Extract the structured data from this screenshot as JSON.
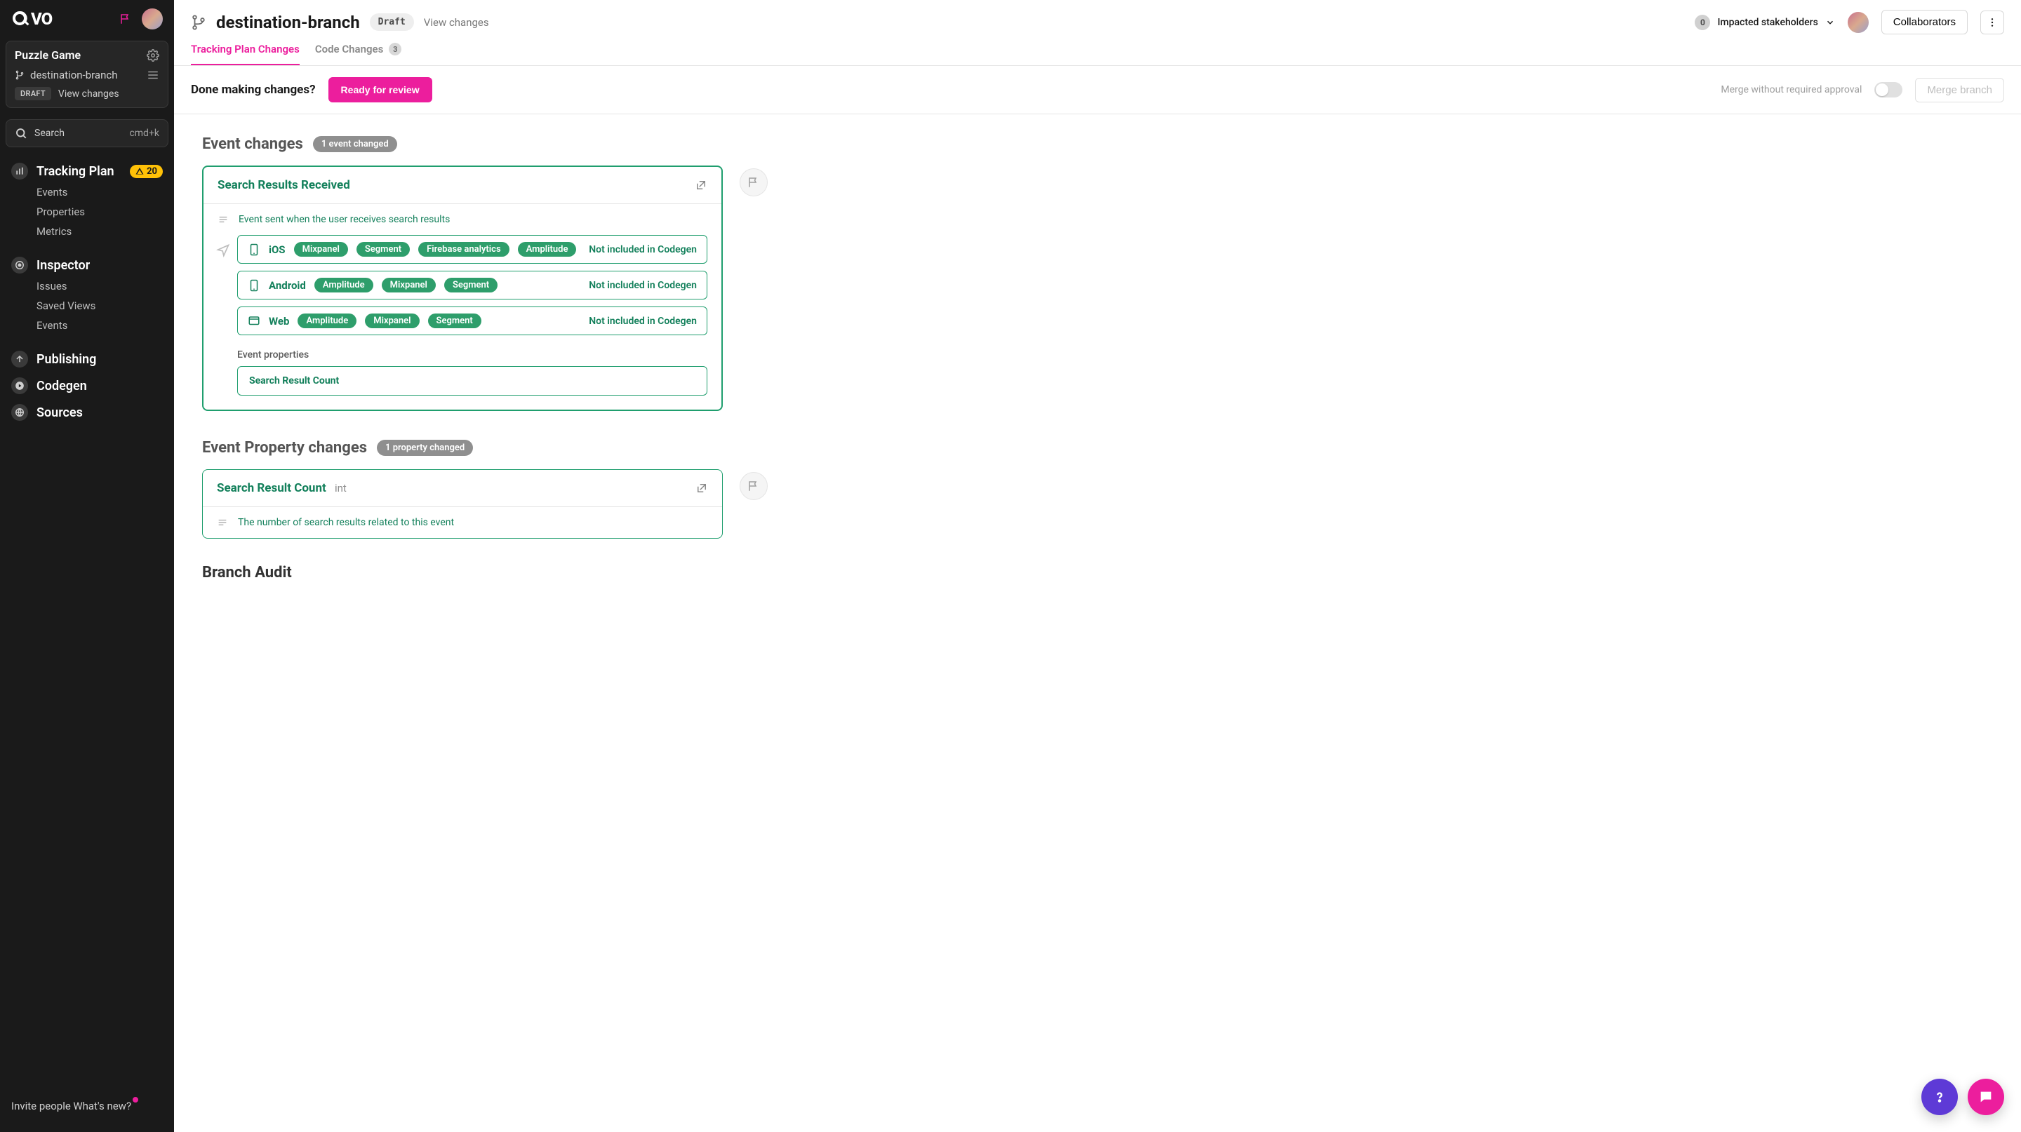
{
  "sidebar": {
    "logo_text": "QVO",
    "project": "Puzzle Game",
    "branch": "destination-branch",
    "draft_tag": "DRAFT",
    "view_changes": "View changes",
    "search_placeholder": "Search",
    "search_shortcut": "cmd+k",
    "sections": {
      "tracking_plan": {
        "label": "Tracking Plan",
        "warn_count": "20",
        "subs": [
          "Events",
          "Properties",
          "Metrics"
        ]
      },
      "inspector": {
        "label": "Inspector",
        "subs": [
          "Issues",
          "Saved Views",
          "Events"
        ]
      },
      "publishing": {
        "label": "Publishing"
      },
      "codegen": {
        "label": "Codegen"
      },
      "sources": {
        "label": "Sources"
      }
    },
    "footer": {
      "invite": "Invite people",
      "whats_new": "What's new?"
    }
  },
  "header": {
    "branch": "destination-branch",
    "draft_chip": "Draft",
    "view_changes": "View changes",
    "stakeholders": {
      "count": "0",
      "label": "Impacted stakeholders"
    },
    "collaborators": "Collaborators"
  },
  "tabs": {
    "tracking": "Tracking Plan Changes",
    "code": "Code Changes",
    "code_count": "3"
  },
  "actionbar": {
    "question": "Done making changes?",
    "ready": "Ready for review",
    "merge_without": "Merge without required approval",
    "merge": "Merge branch"
  },
  "event_section": {
    "title": "Event changes",
    "count": "1 event changed",
    "event": {
      "name": "Search Results Received",
      "description": "Event sent when the user receives search results",
      "platforms": [
        {
          "name": "iOS",
          "icon": "phone",
          "destinations": [
            "Mixpanel",
            "Segment",
            "Firebase analytics",
            "Amplitude"
          ],
          "codegen": "Not included in Codegen"
        },
        {
          "name": "Android",
          "icon": "phone",
          "destinations": [
            "Amplitude",
            "Mixpanel",
            "Segment"
          ],
          "codegen": "Not included in Codegen"
        },
        {
          "name": "Web",
          "icon": "web",
          "destinations": [
            "Amplitude",
            "Mixpanel",
            "Segment"
          ],
          "codegen": "Not included in Codegen"
        }
      ],
      "event_properties_label": "Event properties",
      "event_properties": [
        "Search Result Count"
      ]
    }
  },
  "property_section": {
    "title": "Event Property changes",
    "count": "1 property changed",
    "property": {
      "name": "Search Result Count",
      "type": "int",
      "description": "The number of search results related to this event"
    }
  },
  "audit": {
    "title": "Branch Audit"
  }
}
